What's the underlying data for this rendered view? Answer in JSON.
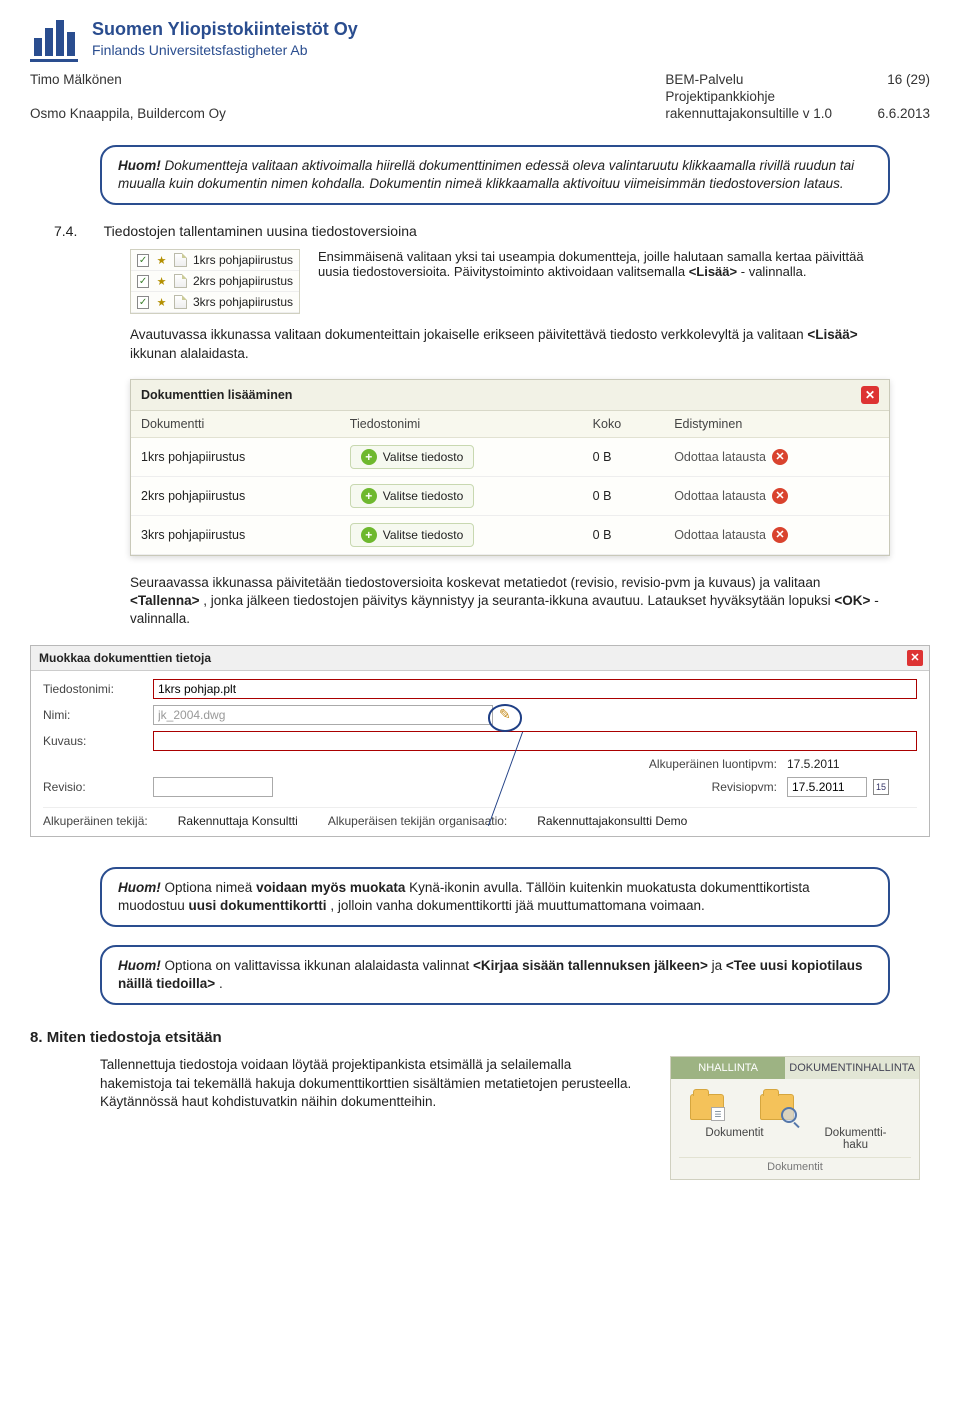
{
  "logo": {
    "line1": "Suomen Yliopistokiinteistöt Oy",
    "line2": "Finlands Universitetsfastigheter Ab"
  },
  "header": {
    "author1": "Timo Mälkönen",
    "author2": "Osmo Knaappila, Buildercom Oy",
    "center1": "BEM-Palvelu",
    "center2": "Projektipankkiohje",
    "center3": "rakennuttajakonsultille v 1.0",
    "page": "16 (29)",
    "date": "6.6.2013"
  },
  "callout1": {
    "huom": "Huom!",
    "text": " Dokumentteja valitaan aktivoimalla hiirellä dokumenttinimen edessä oleva valintaruutu klikkaamalla rivillä ruudun tai muualla kuin dokumentin nimen kohdalla. Dokumentin nimeä klikkaamalla aktivoituu viimeisimmän tiedostoversion lataus."
  },
  "sec74": {
    "num": "7.4.",
    "title": "Tiedostojen tallentaminen uusina tiedostoversioina",
    "filelist": [
      "1krs pohjapiirustus",
      "2krs pohjapiirustus",
      "3krs pohjapiirustus"
    ],
    "para1a": "Ensimmäisenä valitaan yksi tai useampia dokumentteja, joille halutaan samalla kertaa päivittää uusia tiedostoversioita. Päivitystoiminto aktivoidaan valitsemalla ",
    "para1b": "<Lisää>",
    "para1c": " - valinnalla.",
    "para2a": "Avautuvassa ikkunassa valitaan dokumenteittain jokaiselle erikseen päivitettävä tiedosto verkkolevyltä ja valitaan ",
    "para2b": "<Lisää>",
    "para2c": " ikkunan alalaidasta."
  },
  "dlg1": {
    "title": "Dokumenttien lisääminen",
    "headers": {
      "c1": "Dokumentti",
      "c2": "Tiedostonimi",
      "c3": "Koko",
      "c4": "Edistyminen"
    },
    "btn": "Valitse tiedosto",
    "status": "Odottaa latausta",
    "rows": [
      {
        "name": "1krs pohjapiirustus",
        "size": "0 B"
      },
      {
        "name": "2krs pohjapiirustus",
        "size": "0 B"
      },
      {
        "name": "3krs pohjapiirustus",
        "size": "0 B"
      }
    ]
  },
  "para3a": "Seuraavassa ikkunassa päivitetään tiedostoversioita koskevat metatiedot (revisio, revisio-pvm ja kuvaus) ja valitaan ",
  "para3b": "<Tallenna>",
  "para3c": ", jonka jälkeen tiedostojen päivitys käynnistyy ja seuranta-ikkuna avautuu. Lataukset hyväksytään lopuksi ",
  "para3d": "<OK>",
  "para3e": " - valinnalla.",
  "editdlg": {
    "title": "Muokkaa dokumenttien tietoja",
    "labels": {
      "filename": "Tiedostonimi:",
      "name": "Nimi:",
      "desc": "Kuvaus:",
      "rev": "Revisio:",
      "origauthor": "Alkuperäinen tekijä:",
      "origorg": "Alkuperäisen tekijän organisaatio:",
      "origdate": "Alkuperäinen luontipvm:",
      "revdate": "Revisiopvm:"
    },
    "values": {
      "filename": "1krs pohjap.plt",
      "name": "jk_2004.dwg",
      "origauthor": "Rakennuttaja Konsultti",
      "origorg": "Rakennuttajakonsultti Demo",
      "origdate": "17.5.2011",
      "revdate": "17.5.2011",
      "calnum": "15"
    }
  },
  "callout2": {
    "huom": "Huom!",
    "p1a": " Optiona nimeä ",
    "p1b": "voidaan myös muokata",
    "p1c": " Kynä-ikonin avulla. Tällöin kuitenkin muokatusta dokumenttikortista muodostuu ",
    "p1d": "uusi dokumenttikortti",
    "p1e": ", jolloin vanha dokumenttikortti jää muuttumattomana voimaan."
  },
  "callout3": {
    "huom": "Huom!",
    "p1a": " Optiona on valittavissa ikkunan alalaidasta valinnat ",
    "p1b": "<Kirjaa sisään tallennuksen jälkeen>",
    "p1c": " ja ",
    "p1d": "<Tee uusi kopiotilaus näillä tiedoilla>",
    "p1e": "."
  },
  "sec8": {
    "num": "8.",
    "title": "Miten tiedostoja etsitään",
    "text": "Tallennettuja tiedostoja voidaan löytää projektipankista etsimällä ja selailemalla hakemistoja tai tekemällä hakuja dokumenttikorttien sisältämien metatietojen perusteella. Käytännössä haut kohdistuvatkin näihin dokumentteihin.",
    "tab_inactive": "NHALLINTA",
    "tab_active": "DOKUMENTINHALLINTA",
    "icon1": "Dokumentit",
    "icon2": "Dokumentti-\nhaku",
    "group": "Dokumentit"
  }
}
